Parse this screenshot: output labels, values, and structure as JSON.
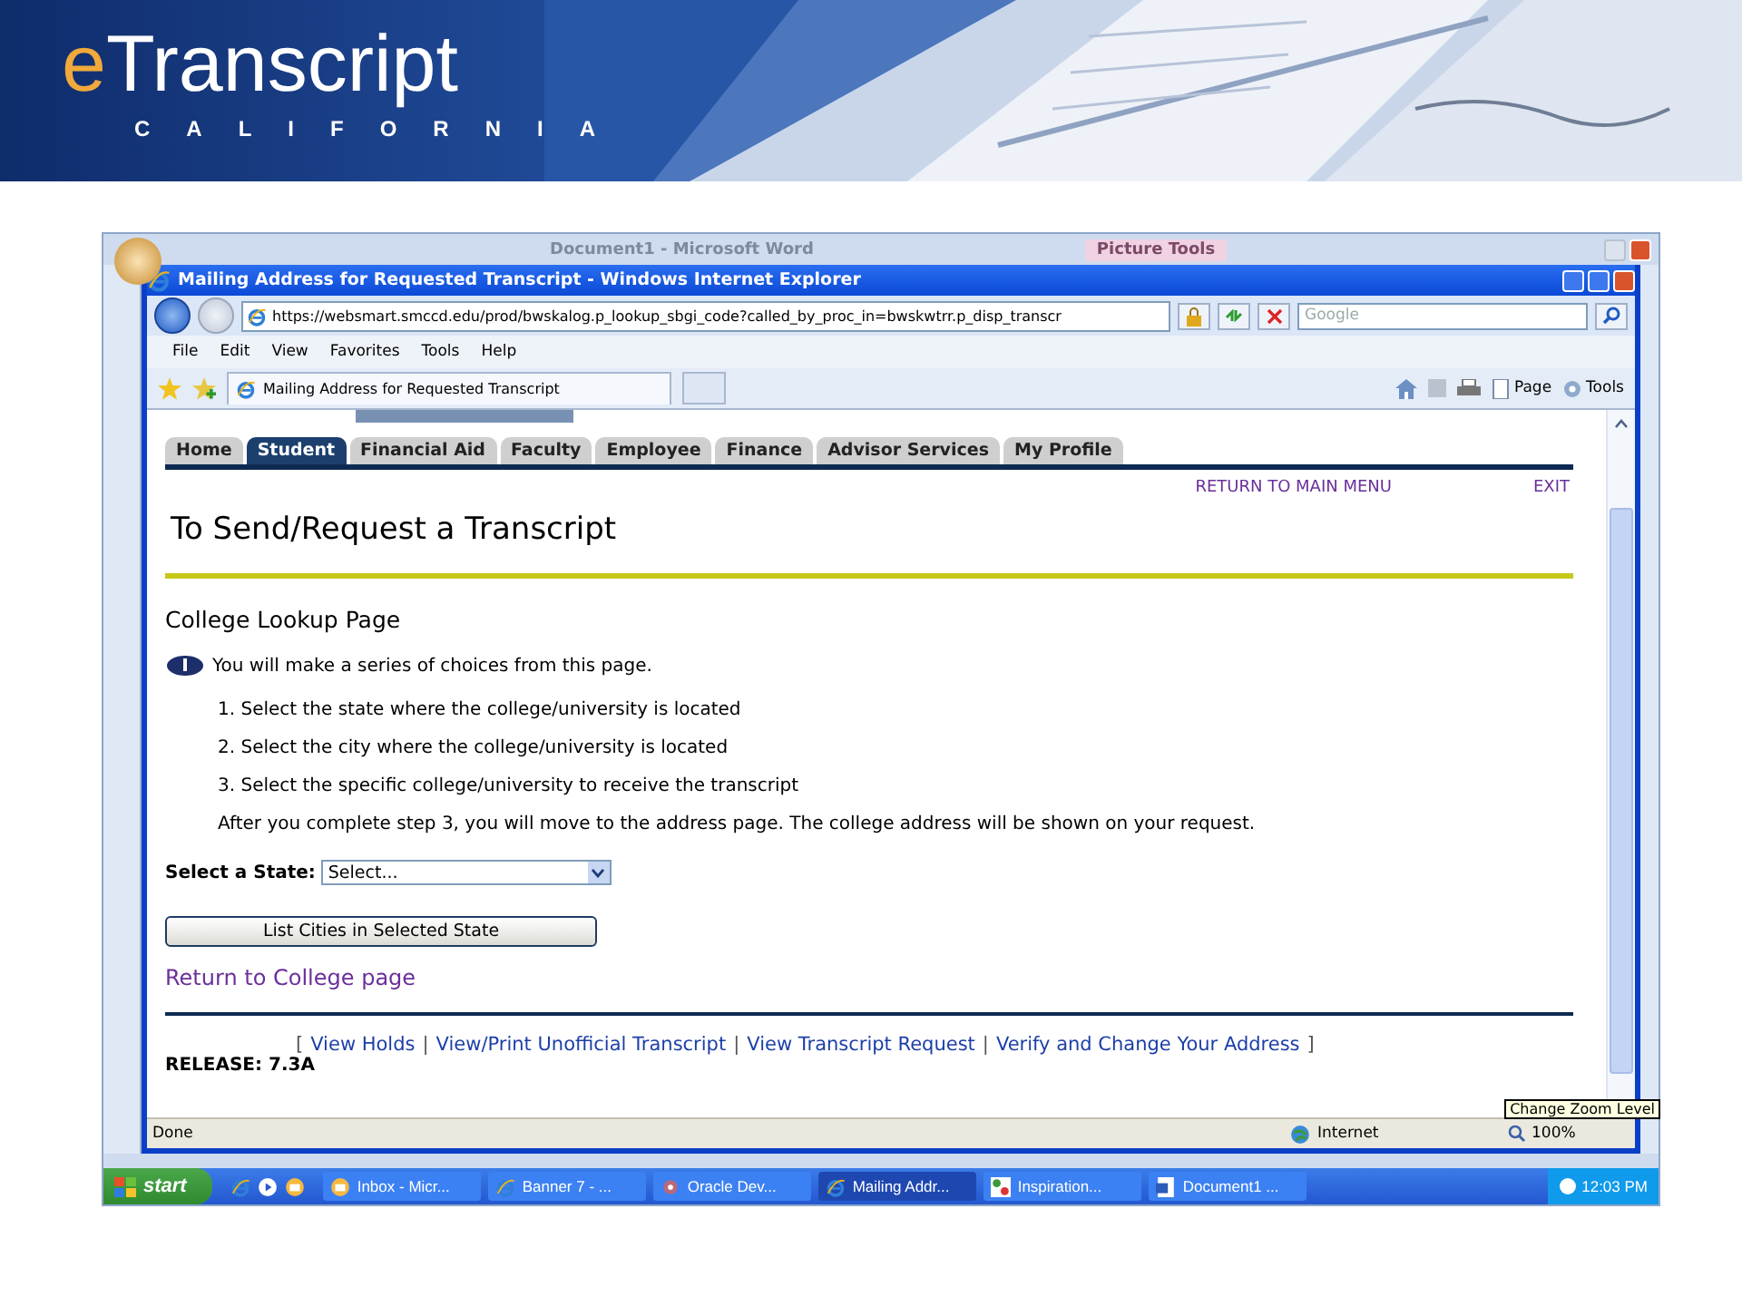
{
  "banner": {
    "logo_accent": "e",
    "logo_name": "Transcript",
    "subtitle": "CALIFORNIA"
  },
  "word": {
    "title": "Document1 - Microsoft Word",
    "contextual_tab": "Picture Tools"
  },
  "browser": {
    "title": "Mailing Address for Requested Transcript - Windows Internet Explorer",
    "url": "https://websmart.smccd.edu/prod/bwskalog.p_lookup_sbgi_code?called_by_proc_in=bwskwtrr.p_disp_transcr",
    "search": {
      "placeholder": "Google"
    },
    "menu": [
      "File",
      "Edit",
      "View",
      "Favorites",
      "Tools",
      "Help"
    ],
    "tab_title": "Mailing Address for Requested Transcript",
    "toolbar": [
      "Page",
      "Tools"
    ],
    "status": "Done",
    "zone": "Internet",
    "zoom": "100%",
    "tooltip": "Change Zoom Level"
  },
  "page": {
    "tabs": [
      {
        "label": "Home",
        "selected": false
      },
      {
        "label": "Student",
        "selected": true
      },
      {
        "label": "Financial Aid",
        "selected": false
      },
      {
        "label": "Faculty",
        "selected": false
      },
      {
        "label": "Employee",
        "selected": false
      },
      {
        "label": "Finance",
        "selected": false
      },
      {
        "label": "Advisor Services",
        "selected": false
      },
      {
        "label": "My Profile",
        "selected": false
      }
    ],
    "top_links": [
      "RETURN TO MAIN MENU",
      "EXIT"
    ],
    "heading": "To Send/Request a Transcript",
    "subheading": "College Lookup Page",
    "info": "You will make a series of choices from this page.",
    "steps": [
      "1. Select the state where the college/university is located",
      "2. Select the city where the college/university is located",
      "3. Select the specific college/university to receive the transcript"
    ],
    "after": "After you complete step 3, you will move to the address page. The college address will be shown on your request.",
    "state_label": "Select a State:",
    "state_select": "Select...",
    "button": "List Cities in Selected State",
    "return_link": "Return to College page",
    "footer": [
      {
        "kind": "bracket",
        "text": "["
      },
      {
        "kind": "link",
        "text": "View Holds"
      },
      {
        "kind": "separator",
        "text": "|"
      },
      {
        "kind": "link",
        "text": "View/Print Unofficial Transcript"
      },
      {
        "kind": "separator",
        "text": "|"
      },
      {
        "kind": "link",
        "text": "View Transcript Request"
      },
      {
        "kind": "separator",
        "text": "|"
      },
      {
        "kind": "link",
        "text": "Verify and Change Your Address"
      },
      {
        "kind": "bracket",
        "text": "]"
      }
    ],
    "release": "RELEASE: 7.3A"
  },
  "taskbar": {
    "start": "start",
    "items": [
      {
        "label": "Inbox - Micr...",
        "kind": "mail",
        "selected": false
      },
      {
        "label": "Banner 7 - ...",
        "kind": "ie",
        "selected": false
      },
      {
        "label": "Oracle Dev...",
        "kind": "oracle",
        "selected": false
      },
      {
        "label": "Mailing Addr...",
        "kind": "ie",
        "selected": true
      },
      {
        "label": "Inspiration...",
        "kind": "app",
        "selected": false
      },
      {
        "label": "Document1 ...",
        "kind": "word",
        "selected": false
      }
    ],
    "clock": "12:03 PM"
  }
}
